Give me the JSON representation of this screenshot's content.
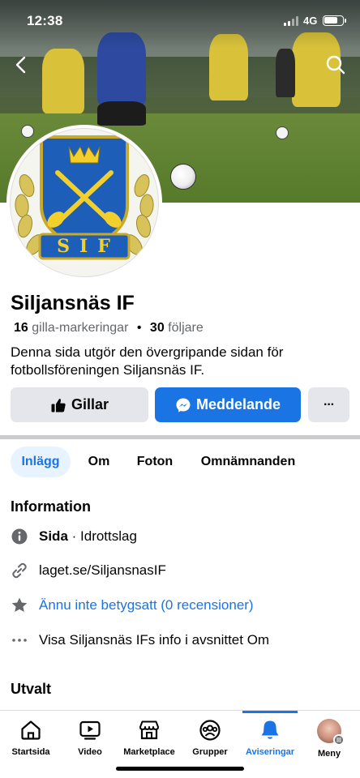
{
  "status_bar": {
    "time": "12:38",
    "network": "4G"
  },
  "page": {
    "name": "Siljansnäs IF",
    "likes_count": "16",
    "likes_label": "gilla-markeringar",
    "separator": "•",
    "followers_count": "30",
    "followers_label": "följare",
    "description": "Denna sida utgör den övergripande sidan för fotbollsföreningen Siljansnäs IF.",
    "logo_text": "SIF"
  },
  "actions": {
    "like_label": "Gillar",
    "message_label": "Meddelande",
    "more_label": "···"
  },
  "tabs": [
    {
      "label": "Inlägg",
      "active": true
    },
    {
      "label": "Om",
      "active": false
    },
    {
      "label": "Foton",
      "active": false
    },
    {
      "label": "Omnämnanden",
      "active": false
    }
  ],
  "information": {
    "title": "Information",
    "category_prefix": "Sida",
    "category_suffix": " · Idrottslag",
    "website": "laget.se/SiljansnasIF",
    "rating": "Ännu inte betygsatt (0 recensioner)",
    "about_link": "Visa Siljansnäs IFs info i avsnittet Om"
  },
  "featured": {
    "title": "Utvalt"
  },
  "bottom_nav": [
    {
      "label": "Startsida",
      "icon": "home-icon"
    },
    {
      "label": "Video",
      "icon": "video-icon"
    },
    {
      "label": "Marketplace",
      "icon": "marketplace-icon"
    },
    {
      "label": "Grupper",
      "icon": "groups-icon"
    },
    {
      "label": "Aviseringar",
      "icon": "bell-icon",
      "active": true
    },
    {
      "label": "Meny",
      "icon": "avatar"
    }
  ],
  "colors": {
    "brand": "#1b74e4",
    "active_tab_bg": "#e7f3ff",
    "button_gray": "#e4e6eb"
  }
}
